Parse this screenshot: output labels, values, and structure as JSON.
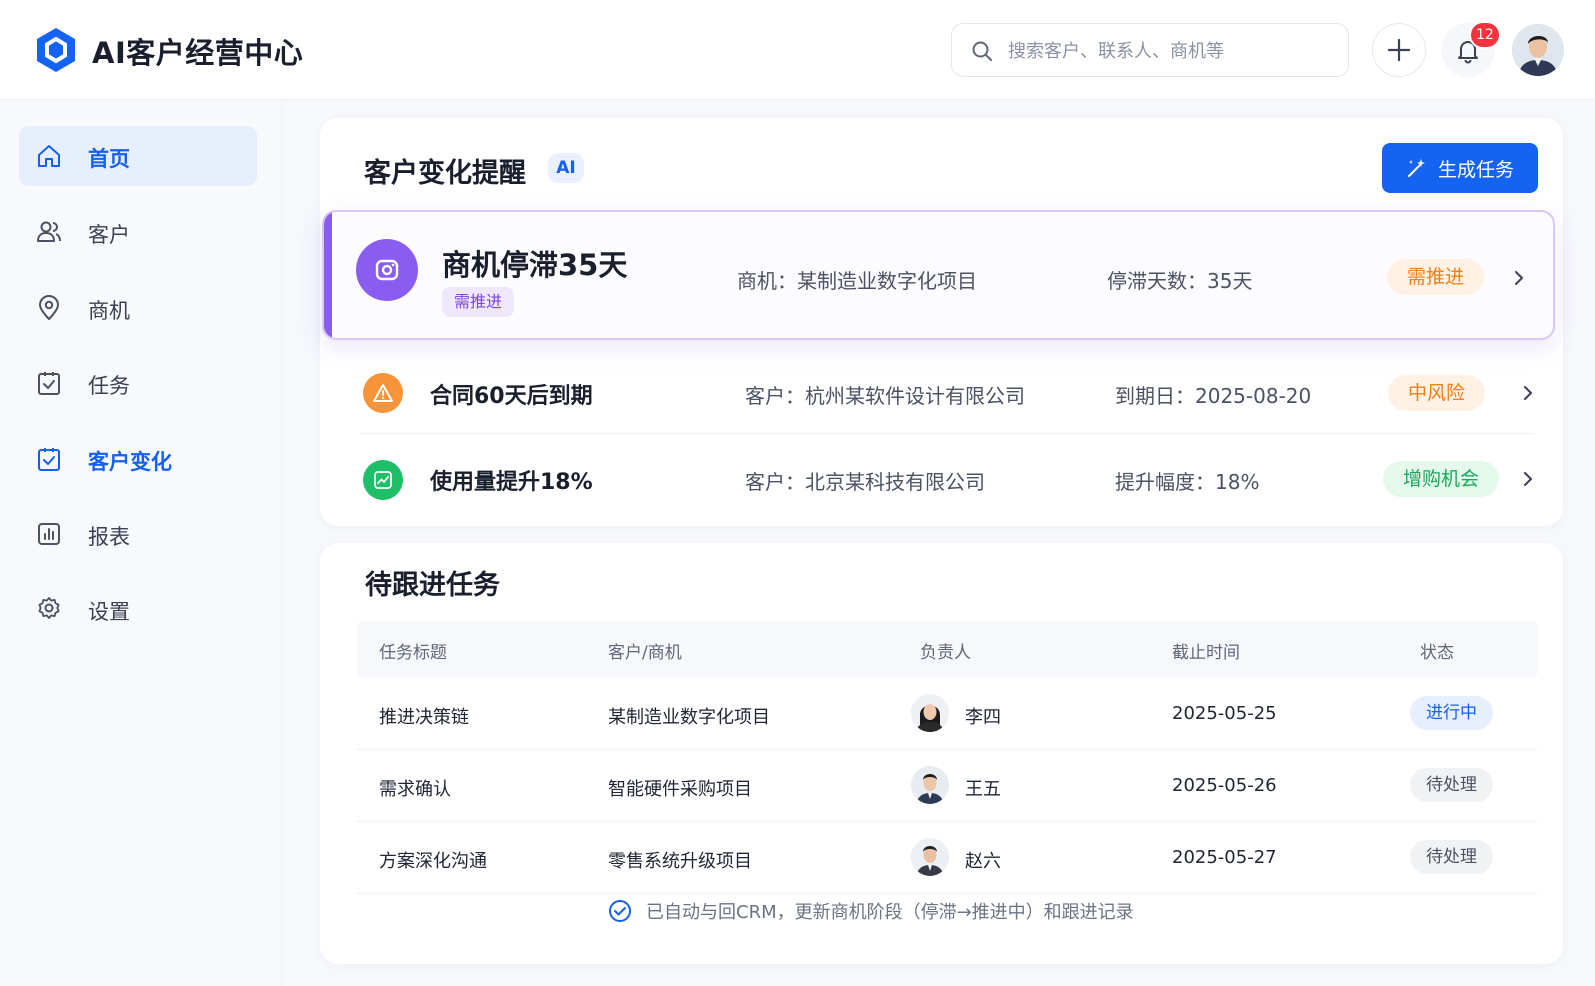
{
  "header": {
    "app_title": "AI客户经营中心",
    "search_placeholder": "搜索客户、联系人、商机等",
    "notification_count": "12"
  },
  "sidebar": {
    "items": [
      {
        "label": "首页",
        "icon": "home-icon",
        "state": "active"
      },
      {
        "label": "客户",
        "icon": "users-icon",
        "state": "normal"
      },
      {
        "label": "商机",
        "icon": "location-pin-icon",
        "state": "normal"
      },
      {
        "label": "任务",
        "icon": "clipboard-check-icon",
        "state": "normal"
      },
      {
        "label": "客户变化",
        "icon": "clipboard-check-icon",
        "state": "highlighted"
      },
      {
        "label": "报表",
        "icon": "bar-chart-icon",
        "state": "normal"
      },
      {
        "label": "设置",
        "icon": "gear-icon",
        "state": "normal"
      }
    ]
  },
  "alerts_card": {
    "title": "客户变化提醒",
    "ai_badge": "AI",
    "generate_button": "生成任务",
    "alerts": [
      {
        "title": "商机停滞35天",
        "subtag": "需推进",
        "meta1": "商机：某制造业数字化项目",
        "meta2": "停滞天数：35天",
        "tag": "需推进",
        "icon": "camera-icon",
        "icon_color": "#8b5cf0"
      },
      {
        "title": "合同60天后到期",
        "meta1": "客户：杭州某软件设计有限公司",
        "meta2": "到期日：2025-08-20",
        "tag": "中风险",
        "icon": "warning-icon",
        "icon_color": "#f7943a"
      },
      {
        "title": "使用量提升18%",
        "meta1": "客户：北京某科技有限公司",
        "meta2": "提升幅度：18%",
        "tag": "增购机会",
        "icon": "trend-up-icon",
        "icon_color": "#1fbf6a"
      }
    ]
  },
  "tasks_card": {
    "title": "待跟进任务",
    "columns": [
      "任务标题",
      "客户/商机",
      "负责人",
      "截止时间",
      "状态"
    ],
    "rows": [
      {
        "task": "推进决策链",
        "project": "某制造业数字化项目",
        "owner": "李四",
        "deadline": "2025-05-25",
        "status": "进行中"
      },
      {
        "task": "需求确认",
        "project": "智能硬件采购项目",
        "owner": "王五",
        "deadline": "2025-05-26",
        "status": "待处理"
      },
      {
        "task": "方案深化沟通",
        "project": "零售系统升级项目",
        "owner": "赵六",
        "deadline": "2025-05-27",
        "status": "待处理"
      }
    ],
    "footnote": "已自动与回CRM，更新商机阶段（停滞→推进中）和跟进记录"
  },
  "colors": {
    "primary": "#1463f3",
    "purple": "#8b5cf0",
    "orange": "#f7943a",
    "green": "#1fbf6a",
    "badge_red": "#f5333f"
  }
}
